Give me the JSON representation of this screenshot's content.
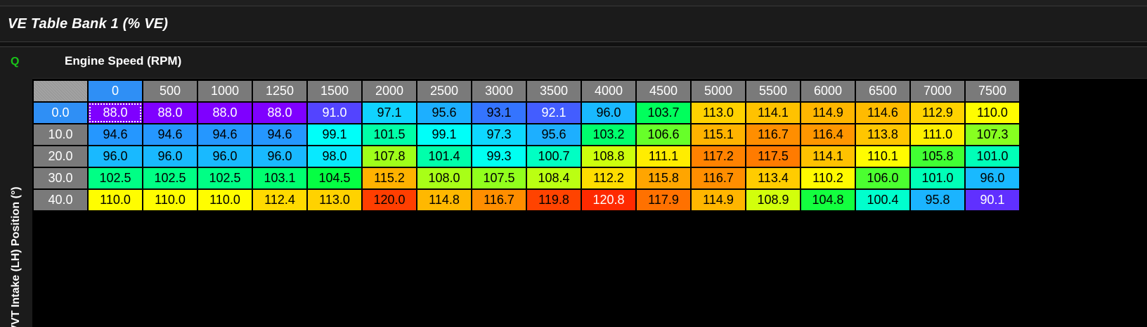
{
  "window": {
    "title": "VE Table Bank 1 (% VE)"
  },
  "toolbar": {
    "q_icon": "Q"
  },
  "axes": {
    "x_label": "Engine Speed (RPM)",
    "y_label": "VVT Intake (LH) Position (°)"
  },
  "table": {
    "columns": [
      "0",
      "500",
      "1000",
      "1250",
      "1500",
      "2000",
      "2500",
      "3000",
      "3500",
      "4000",
      "4500",
      "5000",
      "5500",
      "6000",
      "6500",
      "7000",
      "7500"
    ],
    "selected_column": 0,
    "selected_row": 0,
    "rows": [
      {
        "label": "0.0",
        "values": [
          "88.0",
          "88.0",
          "88.0",
          "88.0",
          "91.0",
          "97.1",
          "95.6",
          "93.1",
          "92.1",
          "96.0",
          "103.7",
          "113.0",
          "114.1",
          "114.9",
          "114.6",
          "112.9",
          "110.0"
        ]
      },
      {
        "label": "10.0",
        "values": [
          "94.6",
          "94.6",
          "94.6",
          "94.6",
          "99.1",
          "101.5",
          "99.1",
          "97.3",
          "95.6",
          "103.2",
          "106.6",
          "115.1",
          "116.7",
          "116.4",
          "113.8",
          "111.0",
          "107.3"
        ]
      },
      {
        "label": "20.0",
        "values": [
          "96.0",
          "96.0",
          "96.0",
          "96.0",
          "98.0",
          "107.8",
          "101.4",
          "99.3",
          "100.7",
          "108.8",
          "111.1",
          "117.2",
          "117.5",
          "114.1",
          "110.1",
          "105.8",
          "101.0"
        ]
      },
      {
        "label": "30.0",
        "values": [
          "102.5",
          "102.5",
          "102.5",
          "103.1",
          "104.5",
          "115.2",
          "108.0",
          "107.5",
          "108.4",
          "112.2",
          "115.8",
          "116.7",
          "113.4",
          "110.2",
          "106.0",
          "101.0",
          "96.0"
        ]
      },
      {
        "label": "40.0",
        "values": [
          "110.0",
          "110.0",
          "110.0",
          "112.4",
          "113.0",
          "120.0",
          "114.8",
          "116.7",
          "119.8",
          "120.8",
          "117.9",
          "114.9",
          "108.9",
          "104.8",
          "100.4",
          "95.8",
          "90.1"
        ]
      }
    ],
    "color_scale": {
      "min": 88.0,
      "max": 120.8,
      "stops": [
        "#7f00ff",
        "#2f7cff",
        "#00ffff",
        "#00ff44",
        "#ffff00",
        "#ffb000",
        "#ff2a00"
      ]
    },
    "header_color": "#7a7a7a",
    "selection_color": "#2f8ff5"
  }
}
